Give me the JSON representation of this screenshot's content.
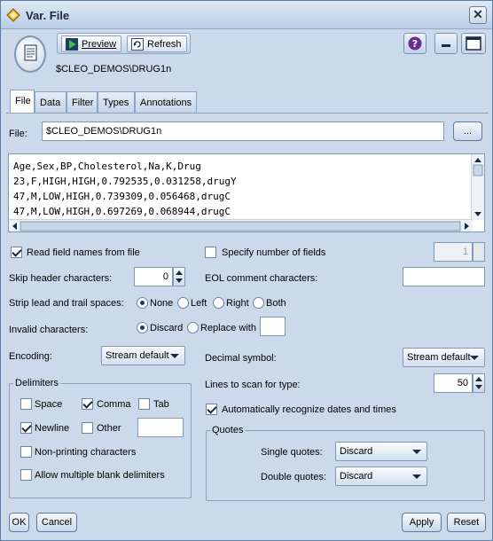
{
  "window": {
    "title": "Var. File",
    "close_glyph": "✕",
    "node_path": "$CLEO_DEMOS\\DRUG1n"
  },
  "toolbar": {
    "preview_label": "Preview",
    "refresh_label": "Refresh"
  },
  "tabs": [
    {
      "label": "File",
      "active": true
    },
    {
      "label": "Data",
      "active": false
    },
    {
      "label": "Filter",
      "active": false
    },
    {
      "label": "Types",
      "active": false
    },
    {
      "label": "Annotations",
      "active": false
    }
  ],
  "file": {
    "label": "File:",
    "value": "$CLEO_DEMOS\\DRUG1n",
    "browse_label": "..."
  },
  "preview_lines": [
    "Age,Sex,BP,Cholesterol,Na,K,Drug",
    "23,F,HIGH,HIGH,0.792535,0.031258,drugY",
    "47,M,LOW,HIGH,0.739309,0.056468,drugC",
    "47,M,LOW,HIGH,0.697269,0.068944,drugC"
  ],
  "options": {
    "read_field_names_label": "Read field names from file",
    "read_field_names_checked": true,
    "specify_fields_label": "Specify number of fields",
    "specify_fields_checked": false,
    "specify_fields_value": "1",
    "skip_header_label": "Skip header characters:",
    "skip_header_value": "0",
    "eol_comment_label": "EOL comment characters:",
    "eol_comment_value": "",
    "strip_label": "Strip lead and trail spaces:",
    "strip_options": [
      {
        "label": "None",
        "checked": true
      },
      {
        "label": "Left",
        "checked": false
      },
      {
        "label": "Right",
        "checked": false
      },
      {
        "label": "Both",
        "checked": false
      }
    ],
    "invalid_label": "Invalid characters:",
    "invalid_options": [
      {
        "label": "Discard",
        "checked": true
      },
      {
        "label": "Replace with",
        "checked": false
      }
    ],
    "replace_value": "",
    "encoding_label": "Encoding:",
    "encoding_value": "Stream default",
    "decimal_label": "Decimal symbol:",
    "decimal_value": "Stream default",
    "lines_scan_label": "Lines to scan for type:",
    "lines_scan_value": "50",
    "auto_dates_label": "Automatically recognize dates and times",
    "auto_dates_checked": true
  },
  "delimiters": {
    "legend": "Delimiters",
    "space_label": "Space",
    "space_checked": false,
    "comma_label": "Comma",
    "comma_checked": true,
    "tab_label": "Tab",
    "tab_checked": false,
    "newline_label": "Newline",
    "newline_checked": true,
    "other_label": "Other",
    "other_checked": false,
    "other_value": "",
    "nonprinting_label": "Non-printing characters",
    "nonprinting_checked": false,
    "multiple_blank_label": "Allow multiple blank delimiters",
    "multiple_blank_checked": false
  },
  "quotes": {
    "legend": "Quotes",
    "single_label": "Single quotes:",
    "single_value": "Discard",
    "double_label": "Double quotes:",
    "double_value": "Discard"
  },
  "footer": {
    "ok_label": "OK",
    "cancel_label": "Cancel",
    "apply_label": "Apply",
    "reset_label": "Reset"
  },
  "colors": {
    "panel_bg": "#cbd9ea",
    "help_icon": "#6a2c8e",
    "preview_icon": "#2e9a3a"
  }
}
